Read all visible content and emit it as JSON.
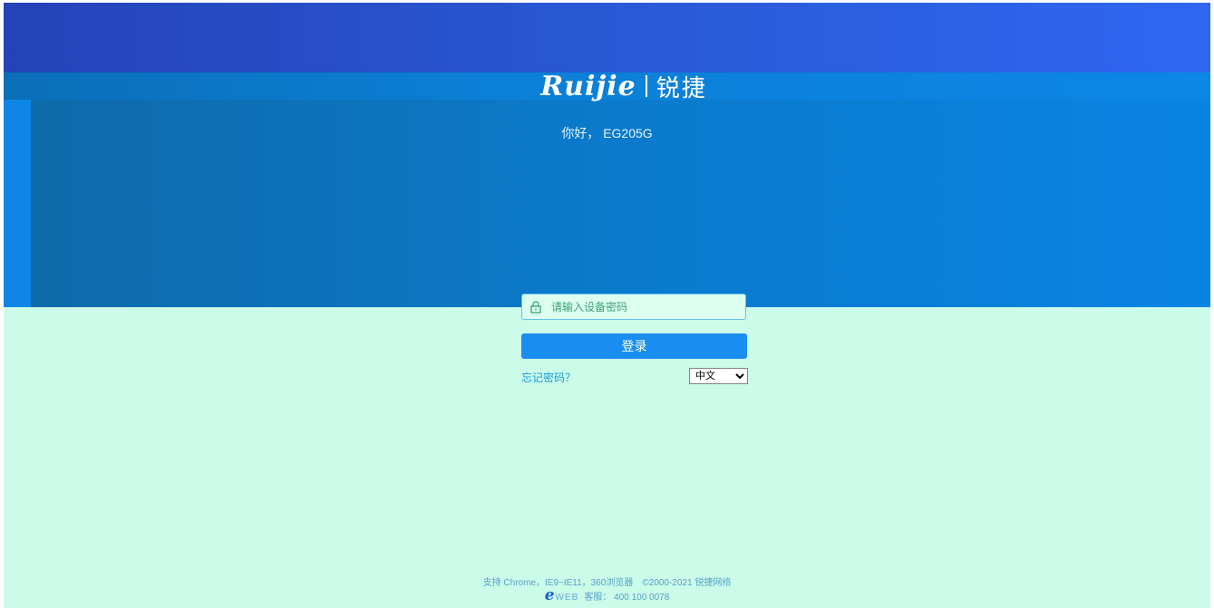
{
  "header": {
    "logo_en": "Ruijie",
    "logo_zh": "锐捷",
    "greeting": "你好， EG205G"
  },
  "login": {
    "password_placeholder": "请输入设备密码",
    "login_button": "登录",
    "forgot_password": "忘记密码？",
    "language_selected": "中文",
    "language_options": [
      "中文"
    ]
  },
  "footer": {
    "line1": "支持 Chrome，IE9~IE11，360浏览器　©2000-2021 锐捷网络",
    "eweb_e": "e",
    "eweb_web": "WEB",
    "support": "客服： 400 100 0078"
  },
  "colors": {
    "top_band": "#2a5ad8",
    "hero": "#0b79c9",
    "lower_bg": "#cbfbe9",
    "login_button": "#1a8ef0",
    "link": "#1a9bd6"
  },
  "icons": {
    "password_field": "lock-icon"
  }
}
